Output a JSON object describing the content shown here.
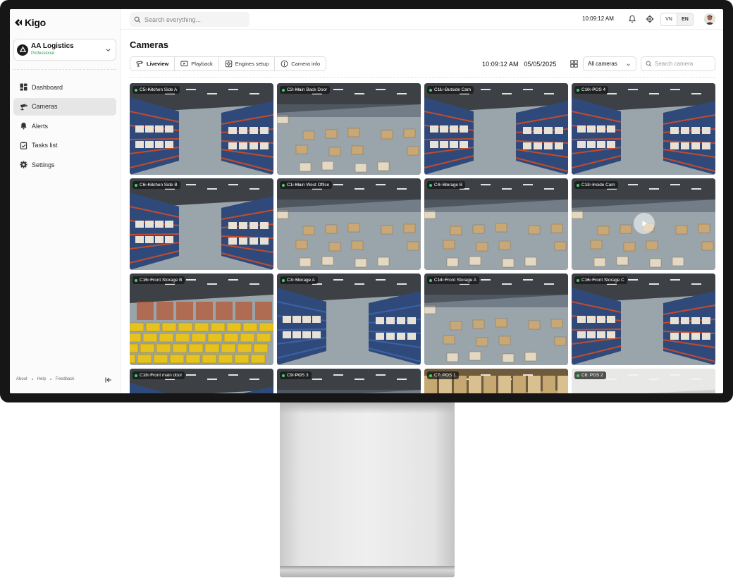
{
  "app": {
    "logo_text": "Kigo"
  },
  "org": {
    "name": "AA Logistics",
    "plan": "Professional"
  },
  "nav": [
    {
      "label": "Dashboard",
      "icon": "dashboard-icon",
      "active": false
    },
    {
      "label": "Cameras",
      "icon": "camera-icon",
      "active": true
    },
    {
      "label": "Alerts",
      "icon": "bell-icon",
      "active": false
    },
    {
      "label": "Tasks list",
      "icon": "tasks-icon",
      "active": false
    },
    {
      "label": "Settings",
      "icon": "gear-icon",
      "active": false
    }
  ],
  "footer": {
    "about": "About",
    "help": "Help",
    "feedback": "Feedback"
  },
  "topbar": {
    "search_placeholder": "Search everything...",
    "time": "10:09:12 AM",
    "lang_vn": "VN",
    "lang_en": "EN"
  },
  "page": {
    "title": "Cameras",
    "tabs": [
      {
        "label": "Liveview",
        "icon": "liveview-icon",
        "active": true
      },
      {
        "label": "Playback",
        "icon": "playback-icon",
        "active": false
      },
      {
        "label": "Engines setup",
        "icon": "engine-icon",
        "active": false
      },
      {
        "label": "Camera info",
        "icon": "info-icon",
        "active": false
      }
    ],
    "time": "10:09:12 AM",
    "date": "05/05/2025",
    "filter_selected": "All cameras",
    "camera_search_placeholder": "Search camera"
  },
  "colors": {
    "live": "#3ed36c",
    "plan": "#2f9a4e",
    "active_nav": "#e6e6e6"
  },
  "cameras": [
    {
      "label": "C5: Kitchen Side A"
    },
    {
      "label": "C2: Main Back Door"
    },
    {
      "label": "C11: Outside Cam"
    },
    {
      "label": "C10: POS 4"
    },
    {
      "label": "C6: Kitchen Side B"
    },
    {
      "label": "C1: Main West Office"
    },
    {
      "label": "C4: Storage B"
    },
    {
      "label": "C12: Inside Cam"
    },
    {
      "label": "C15: Front Storage B"
    },
    {
      "label": "C3: Storage A"
    },
    {
      "label": "C14: Front Storage A"
    },
    {
      "label": "C16: Front Storage C"
    },
    {
      "label": "C13: Front main door"
    },
    {
      "label": "C9: POS 3"
    },
    {
      "label": "C7: POS 1"
    },
    {
      "label": "C8: POS 2"
    }
  ]
}
